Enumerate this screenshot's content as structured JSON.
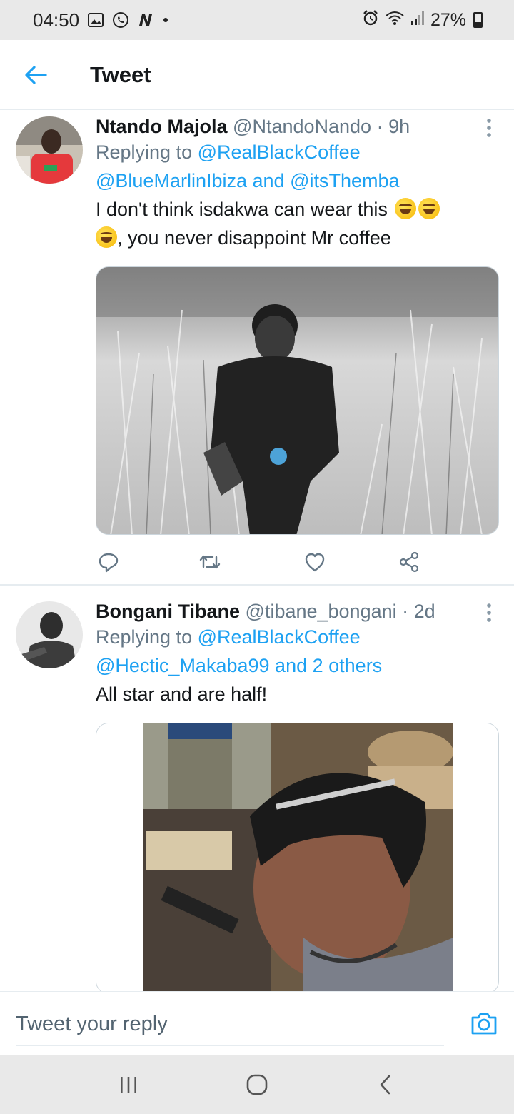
{
  "status_bar": {
    "time": "04:50",
    "battery": "27%",
    "icons": [
      "gallery-icon",
      "whatsapp-icon",
      "n-icon",
      "dot-icon",
      "alarm-icon",
      "wifi-icon",
      "signal-icon",
      "battery-icon"
    ]
  },
  "header": {
    "title": "Tweet"
  },
  "tweets": [
    {
      "name": "Ntando Majola",
      "handle": "@NtandoNando",
      "separator": "·",
      "time": "9h",
      "reply_prefix": "Replying to",
      "reply_mention_1": "@RealBlackCoffee",
      "reply_mention_2": "@BlueMarlinIbiza",
      "reply_and": "and",
      "reply_mention_3": "@itsThemba",
      "text_1": "I don't think isdakwa can wear this",
      "text_2": ", you never disappoint Mr coffee"
    },
    {
      "name": "Bongani Tibane",
      "handle": "@tibane_bongani",
      "separator": "·",
      "time": "2d",
      "reply_prefix": "Replying to",
      "reply_mention_1": "@RealBlackCoffee",
      "reply_mention_2": "@Hectic_Makaba99",
      "reply_and": "and",
      "reply_others": "2 others",
      "text_1": "All star and are half!"
    }
  ],
  "reply_bar": {
    "placeholder": "Tweet your reply"
  },
  "colors": {
    "accent": "#1da1f2",
    "secondary_text": "#657786",
    "status_bar_bg": "#e9e9e9"
  }
}
